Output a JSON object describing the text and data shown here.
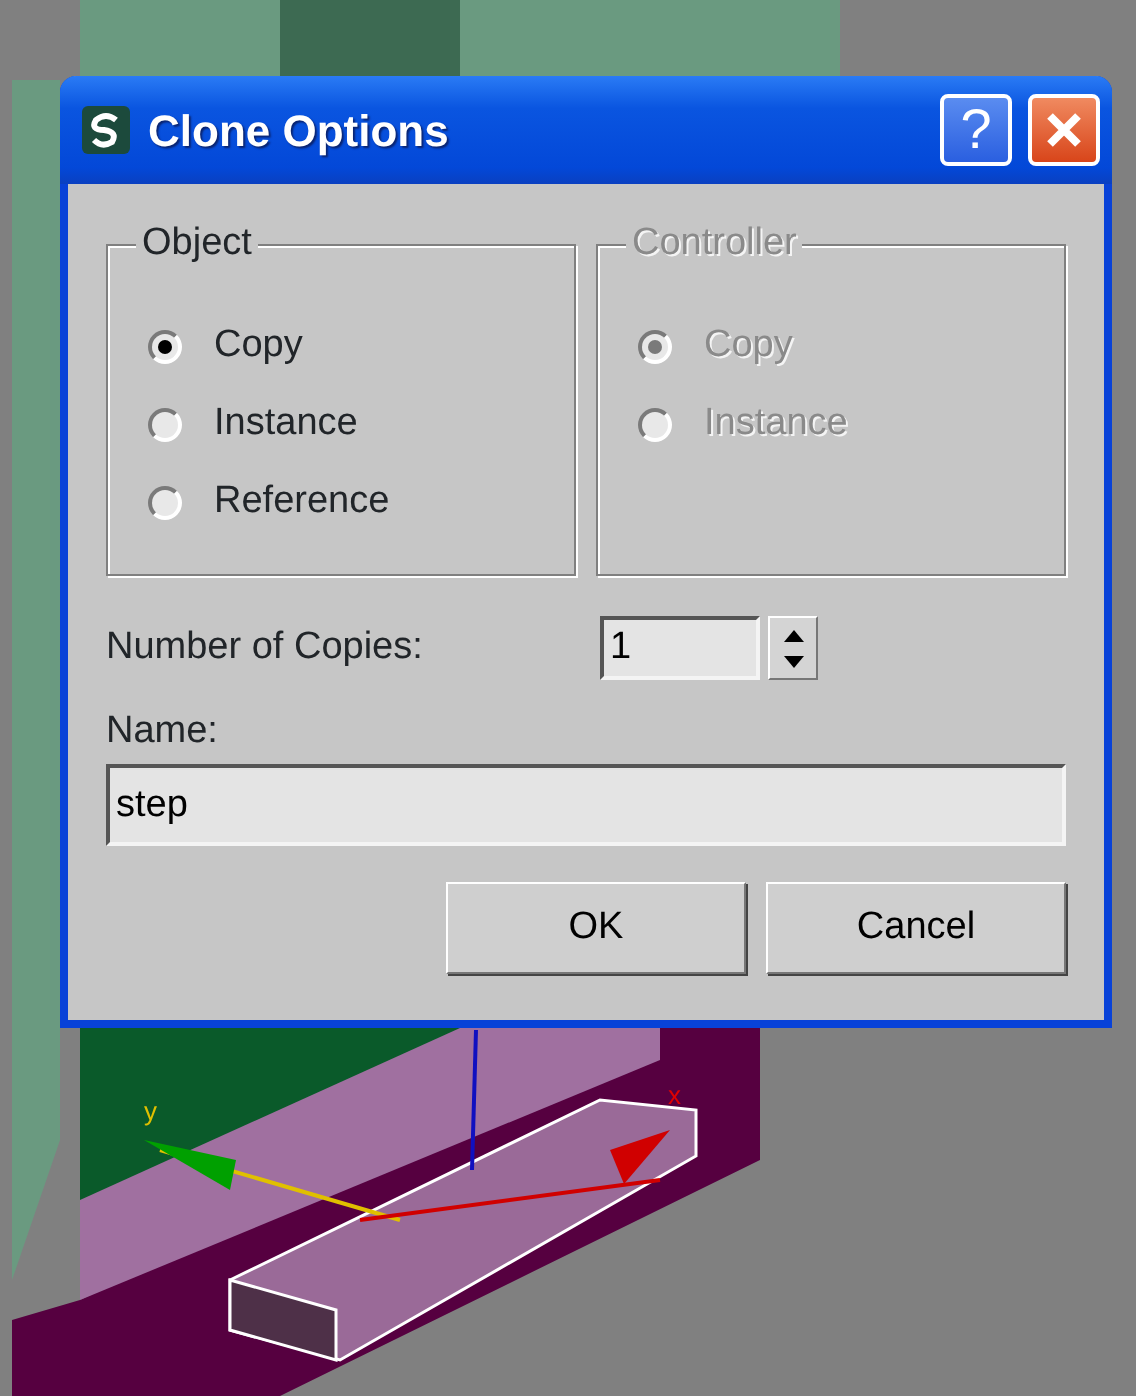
{
  "window": {
    "title": "Clone Options",
    "help_label": "?"
  },
  "groups": [
    {
      "label": "Object",
      "disabled": false,
      "options": [
        {
          "label": "Copy",
          "selected": true
        },
        {
          "label": "Instance",
          "selected": false
        },
        {
          "label": "Reference",
          "selected": false
        }
      ]
    },
    {
      "label": "Controller",
      "disabled": true,
      "options": [
        {
          "label": "Copy",
          "selected": true
        },
        {
          "label": "Instance",
          "selected": false
        }
      ]
    }
  ],
  "number_of_copies": {
    "label": "Number of Copies:",
    "value": "1"
  },
  "name": {
    "label": "Name:",
    "value": "step"
  },
  "buttons": [
    "OK",
    "Cancel"
  ],
  "viewport": {
    "axis_labels": [
      "y",
      "x"
    ]
  }
}
